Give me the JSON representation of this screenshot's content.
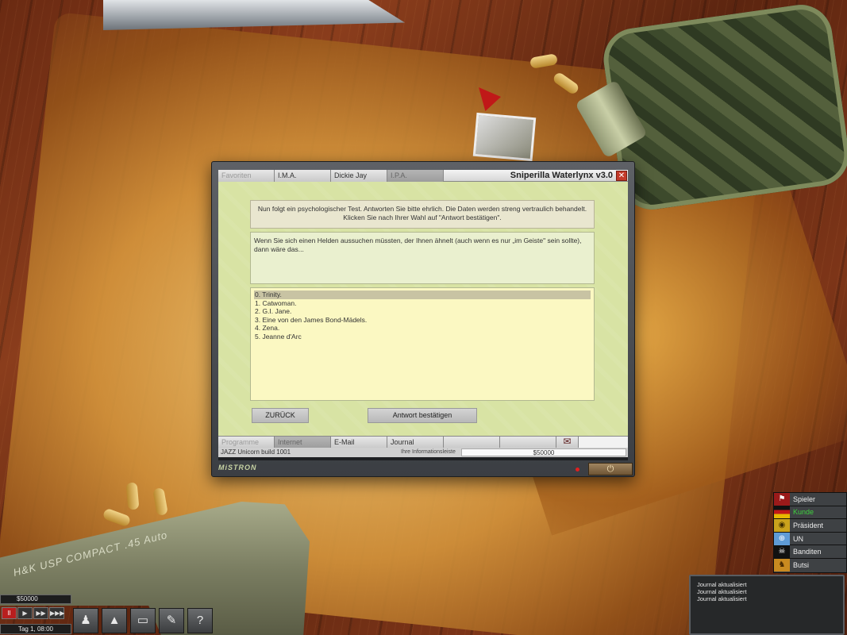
{
  "window": {
    "title": "Sniperilla Waterlynx v3.0",
    "close_glyph": "✕",
    "top_tabs": [
      "Favoriten",
      "I.M.A.",
      "Dickie Jay",
      "I.P.A."
    ],
    "intro_line1": "Nun folgt ein psychologischer Test. Antworten Sie bitte ehrlich. Die Daten werden streng vertraulich behandelt.",
    "intro_line2": "Klicken Sie nach Ihrer Wahl auf \"Antwort bestätigen\".",
    "question": "Wenn Sie sich einen Helden aussuchen müssten, der Ihnen ähnelt (auch wenn es nur „im Geiste\" sein sollte), dann wäre das...",
    "answers": [
      "0. Trinity.",
      "1. Catwoman.",
      "2. G.I. Jane.",
      "3. Eine von den James Bond-Mädels.",
      "4. Zena.",
      "5. Jeanne d'Arc"
    ],
    "back_button": "ZURÜCK",
    "confirm_button": "Antwort bestätigen",
    "bottom_tabs": [
      "Programme",
      "Internet",
      "E-Mail",
      "Journal"
    ],
    "envelope_glyph": "✉",
    "build_text": "JAZZ Unicorn build 1001",
    "info_label": "Ihre Informationsleiste",
    "balance": "$50000",
    "brand": "MiSTRON",
    "power_glyph": "⏻"
  },
  "factions": [
    {
      "label": "Spieler",
      "icon": "flag-icon",
      "glyph": "⚑",
      "color": "#ececec"
    },
    {
      "label": "Kunde",
      "icon": "flag-icon",
      "glyph": "▬",
      "color": "#3fd13f"
    },
    {
      "label": "Präsident",
      "icon": "seal-icon",
      "glyph": "◉",
      "color": "#ececec"
    },
    {
      "label": "UN",
      "icon": "globe-icon",
      "glyph": "⊕",
      "color": "#ececec"
    },
    {
      "label": "Banditen",
      "icon": "skull-icon",
      "glyph": "☠",
      "color": "#ececec"
    },
    {
      "label": "Butsi",
      "icon": "lion-icon",
      "glyph": "♞",
      "color": "#ececec"
    }
  ],
  "journal": {
    "lines": [
      "Journal aktualisiert",
      "Journal aktualisiert",
      "Journal aktualisiert"
    ]
  },
  "hud": {
    "money": "$50000",
    "day": "Tag 1, 08:00",
    "controls": [
      "II",
      "▶",
      "▶▶",
      "▶▶▶"
    ],
    "buttons": [
      {
        "name": "team-icon",
        "glyph": "♟"
      },
      {
        "name": "map-icon",
        "glyph": "▲"
      },
      {
        "name": "laptop-icon",
        "glyph": "▭"
      },
      {
        "name": "tools-icon",
        "glyph": "✎"
      },
      {
        "name": "help-icon",
        "glyph": "?"
      }
    ]
  },
  "scene": {
    "gun_text": "H&K USP COMPACT .45 Auto"
  }
}
